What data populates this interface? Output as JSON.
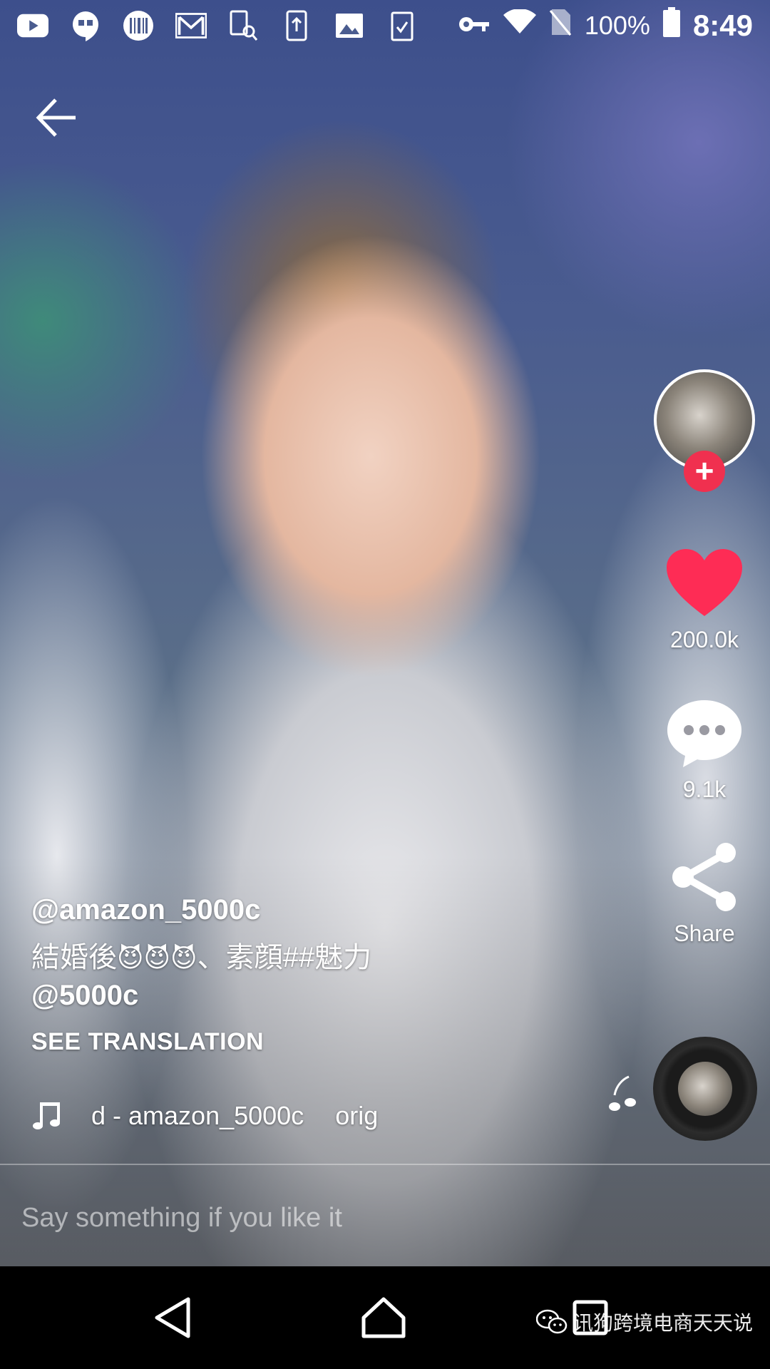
{
  "status_bar": {
    "icons": [
      "youtube-icon",
      "hangouts-icon",
      "barcode-icon",
      "gmail-icon",
      "search-app-icon",
      "download-icon",
      "image-icon",
      "clipboard-icon"
    ],
    "right_icons": [
      "key-icon",
      "wifi-icon",
      "no-sim-icon",
      "battery-icon"
    ],
    "battery": "100%",
    "time": "8:49"
  },
  "video": {
    "author": "@amazon_5000c",
    "description_text": "結婚後",
    "description_emojis": "😈😈😈",
    "description_suffix": "、素顔##魅力",
    "mention": "@5000c",
    "see_translation": "SEE TRANSLATION",
    "sound": {
      "icon": "music-note-icon",
      "text_part1": "d - amazon_5000c",
      "text_part2": "orig"
    }
  },
  "actions": {
    "like_count": "200.0k",
    "comment_count": "9.1k",
    "share_label": "Share",
    "follow_symbol": "+"
  },
  "comment": {
    "placeholder": "Say something if you like it"
  },
  "nav": {
    "watermark": "讯狗跨境电商天天说"
  },
  "colors": {
    "like": "#fe2c55",
    "follow": "#f0304f",
    "nav_bg": "#000000"
  }
}
